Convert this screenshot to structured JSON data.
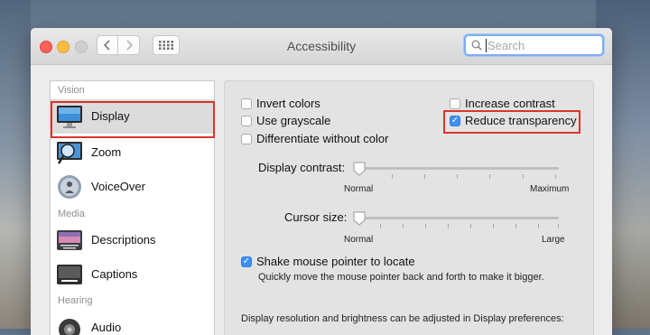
{
  "window": {
    "title": "Accessibility",
    "search_placeholder": "Search",
    "icons": {
      "back": "chevron-left-icon",
      "forward": "chevron-right-icon",
      "grid": "grid-icon",
      "search": "magnifier-icon"
    }
  },
  "sidebar": {
    "sections": [
      {
        "label": "Vision"
      },
      {
        "label": "Media"
      },
      {
        "label": "Hearing"
      }
    ],
    "items": [
      {
        "label": "Display",
        "icon": "display-icon",
        "selected": true
      },
      {
        "label": "Zoom",
        "icon": "zoom-icon"
      },
      {
        "label": "VoiceOver",
        "icon": "voiceover-icon"
      },
      {
        "label": "Descriptions",
        "icon": "descriptions-icon"
      },
      {
        "label": "Captions",
        "icon": "captions-icon"
      },
      {
        "label": "Audio",
        "icon": "audio-icon"
      }
    ]
  },
  "display": {
    "invert_colors": {
      "label": "Invert colors",
      "checked": false
    },
    "use_grayscale": {
      "label": "Use grayscale",
      "checked": false
    },
    "differentiate": {
      "label": "Differentiate without color",
      "checked": false
    },
    "increase_contrast": {
      "label": "Increase contrast",
      "checked": false
    },
    "reduce_transparency": {
      "label": "Reduce transparency",
      "checked": true
    },
    "contrast": {
      "label": "Display contrast:",
      "min_label": "Normal",
      "max_label": "Maximum",
      "value": 0
    },
    "cursor": {
      "label": "Cursor size:",
      "min_label": "Normal",
      "max_label": "Large",
      "value": 0
    },
    "shake": {
      "label": "Shake mouse pointer to locate",
      "checked": true,
      "description": "Quickly move the mouse pointer back and forth to make it bigger."
    },
    "footer": "Display resolution and brightness can be adjusted in Display preferences:"
  },
  "colors": {
    "accent": "#3f8ef2",
    "highlight": "#d9352b"
  }
}
